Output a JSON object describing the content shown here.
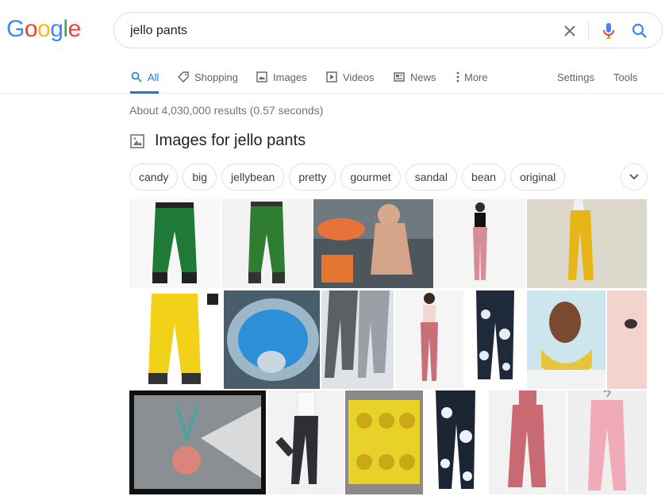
{
  "logo": {
    "letters": [
      "G",
      "o",
      "o",
      "g",
      "l",
      "e"
    ],
    "colors": [
      "#4285F4",
      "#EA4335",
      "#FBBC05",
      "#4285F4",
      "#34A853",
      "#EA4335"
    ]
  },
  "search": {
    "query": "jello pants",
    "clear_icon": "close-icon",
    "mic_icon": "microphone-icon",
    "search_icon": "search-icon"
  },
  "tabs": {
    "all": "All",
    "shopping": "Shopping",
    "images": "Images",
    "videos": "Videos",
    "news": "News",
    "more": "More",
    "settings": "Settings",
    "tools": "Tools"
  },
  "accent_color": "#1a73e8",
  "result_stats": "About 4,030,000 results (0.57 seconds)",
  "images_section": {
    "title": "Images for jello pants"
  },
  "chips": [
    "candy",
    "big",
    "jellybean",
    "pretty",
    "gourmet",
    "sandal",
    "bean",
    "original"
  ]
}
